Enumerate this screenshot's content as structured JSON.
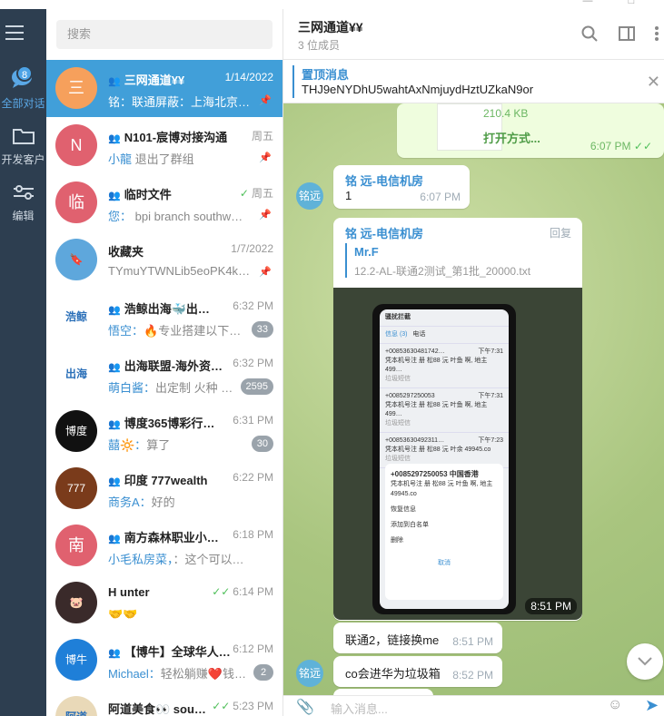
{
  "sidebar": {
    "badge": "8",
    "items": [
      {
        "label": "全部对话"
      },
      {
        "label": "开发客户"
      },
      {
        "label": "编辑"
      }
    ]
  },
  "search": {
    "placeholder": "搜索"
  },
  "chats": [
    {
      "avatar_text": "三",
      "avatar_color": "#f6a05c",
      "name": "三网通道¥¥",
      "group": true,
      "time": "1/14/2022",
      "sender": "铭：",
      "preview": "联通屏蔽：上海北京…",
      "pinned": true,
      "selected": true
    },
    {
      "avatar_text": "N",
      "avatar_color": "#e0616f",
      "name": "N101-宸博对接沟通",
      "group": true,
      "time": "周五",
      "sender": "小龍",
      "preview": " 退出了群组",
      "pinned": true
    },
    {
      "avatar_text": "临",
      "avatar_color": "#e0616f",
      "name": "临时文件",
      "group": true,
      "time": "周五",
      "sender": "您：",
      "preview": " bpi branch southw…",
      "pinned": true,
      "tick": "✓"
    },
    {
      "avatar_text": "🔖",
      "avatar_color": "#5ea7dc",
      "name": "收藏夹",
      "group": false,
      "time": "1/7/2022",
      "sender": "",
      "preview": "TYmuYTWNLib5eoPK4kZ…",
      "pinned": true
    },
    {
      "avatar_text": "浩鲸",
      "avatar_color": "#ffffff",
      "name": "浩鲸出海🐳出…",
      "group": true,
      "time": "6:32 PM",
      "sender": "悟空：",
      "preview": "🔥专业搭建以下…",
      "unread": "33"
    },
    {
      "avatar_text": "出海",
      "avatar_color": "#ffffff",
      "name": "出海联盟-海外资…",
      "group": true,
      "time": "6:32 PM",
      "sender": "萌白酱：",
      "preview": "出定制 火种 …",
      "unread": "2595"
    },
    {
      "avatar_text": "博度",
      "avatar_color": "#111111",
      "name": "博度365博彩行…",
      "group": true,
      "time": "6:31 PM",
      "sender": "囍🔆：",
      "preview": "算了",
      "unread": "30"
    },
    {
      "avatar_text": "777",
      "avatar_color": "#7a3b1b",
      "name": "印度 777wealth",
      "group": true,
      "time": "6:22 PM",
      "sender": "商务A：",
      "preview": "好的"
    },
    {
      "avatar_text": "南",
      "avatar_color": "#e0616f",
      "name": "南方森林职业小…",
      "group": true,
      "time": "6:18 PM",
      "sender": "小毛私房菜，",
      "preview": "：这个可以拿来…"
    },
    {
      "avatar_text": "🐷",
      "avatar_color": "#3a2a2a",
      "name": "H unter",
      "group": false,
      "time": "6:14 PM",
      "sender": "",
      "preview": "🤝🤝",
      "tick": "✓✓"
    },
    {
      "avatar_text": "博牛",
      "avatar_color": "#1f7fd8",
      "name": "【博牛】全球华人…",
      "group": true,
      "time": "6:12 PM",
      "sender": "Michael：",
      "preview": "轻松躺赚❤️钱…",
      "unread": "2"
    },
    {
      "avatar_text": "阿道",
      "avatar_color": "#e9d9b8",
      "name": "阿道美食👀 sou…",
      "group": false,
      "time": "5:23 PM",
      "sender": "",
      "preview": "OK",
      "tick": "✓✓"
    }
  ],
  "header": {
    "title": "三网通道¥¥",
    "subtitle": "3 位成员"
  },
  "pinned_msg": {
    "title": "置顶消息",
    "text": "THJ9eNYDhU5wahtAxNmjuydHztUZkaN9or"
  },
  "messages": {
    "file_size": "210.4 KB",
    "file_action": "打开方式...",
    "file_time": "6:07 PM",
    "avatar_label": "铭远",
    "msg1_author": "铭 远-电信机房",
    "msg1_text": "1",
    "msg1_time": "6:07 PM",
    "msg2_author": "铭 远-电信机房",
    "msg2_reply": "回复",
    "msg2_fwd_name": "Mr.F",
    "msg2_fwd_text": "12.2-AL-联通2测试_第1批_20000.txt",
    "photo_time": "8:51 PM",
    "msg3_text": "联通2，链接换me",
    "msg3_time": "8:51 PM",
    "msg4_text": "co会进华为垃圾箱",
    "msg4_time": "8:52 PM",
    "input_placeholder": "输入消息..."
  },
  "phone_screen": {
    "header": "骚扰拦截",
    "tab1": "信息 (3)",
    "tab2": "电话",
    "rows": [
      {
        "num": "+0085363048174​2…",
        "time": "下午7:31",
        "text": "凭本机号注 册 松88 沅 叶鱼 啊, 地主 499…",
        "tag": "垃圾短信"
      },
      {
        "num": "+0085297250053",
        "time": "下午7:31",
        "text": "凭本机号注 册 松88 沅 叶鱼 啊, 地主 499…",
        "tag": "垃圾短信"
      },
      {
        "num": "+0085363049231​1…",
        "time": "下午7:23",
        "text": "凭本机号注 册 松88 沅 叶余 49945.co",
        "tag": "垃圾短信"
      }
    ],
    "popup_title": "+0085297250053 中国香港",
    "popup_body": "凭本机号注 册 松88 沅 叶鱼 啊, 地主 49945.co",
    "opt1": "恢复信息",
    "opt2": "添加到白名单",
    "opt3": "删除",
    "cancel": "取消"
  }
}
